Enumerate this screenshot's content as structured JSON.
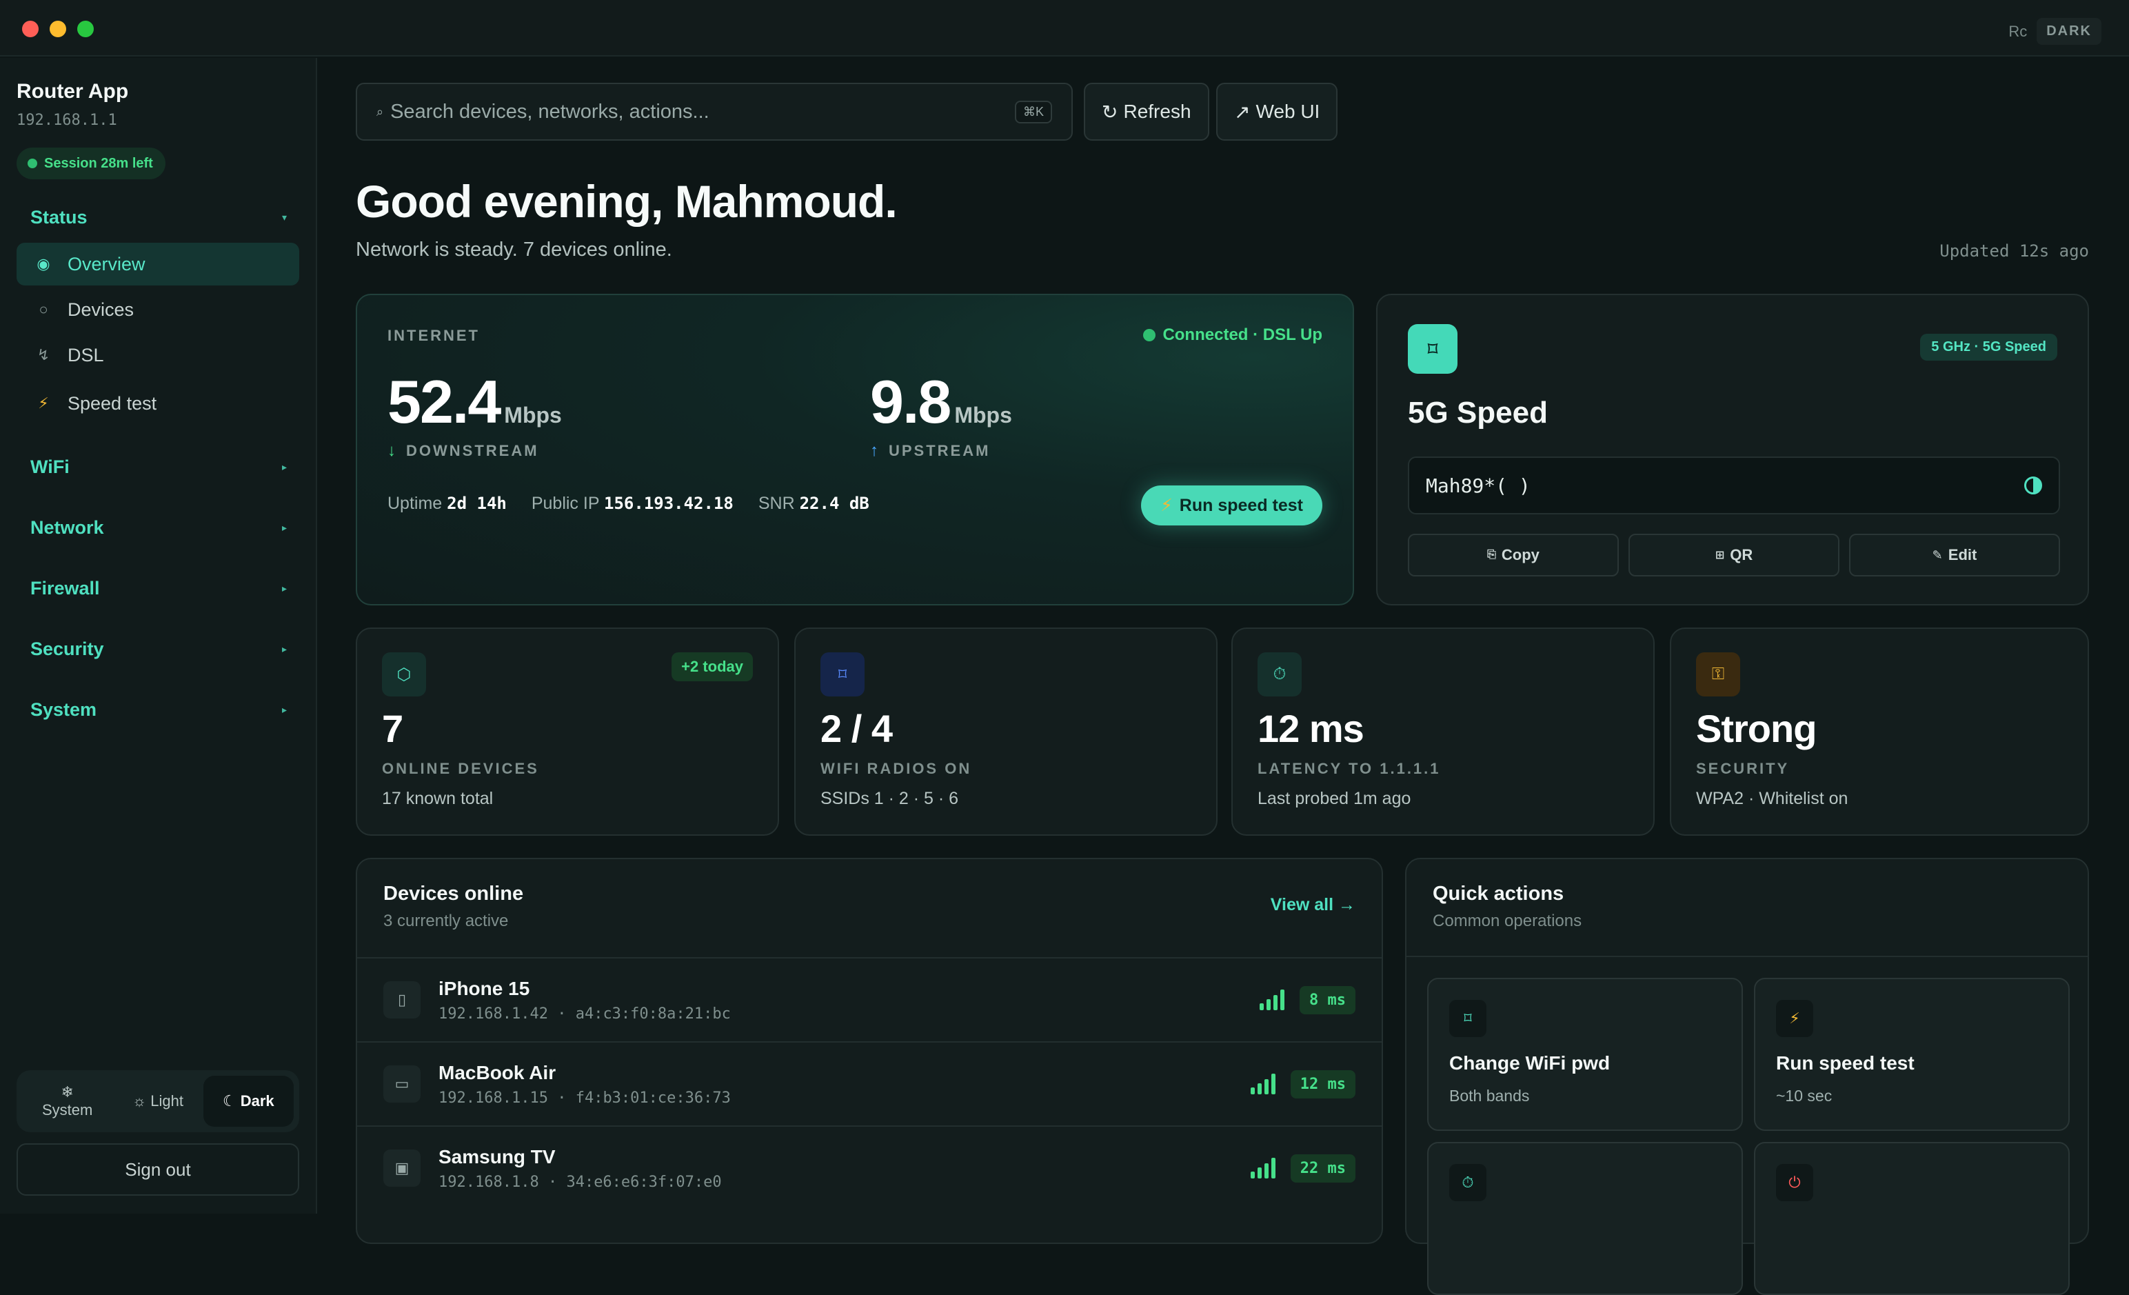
{
  "titlebar": {
    "rc": "Rc",
    "mode": "DARK"
  },
  "sidebar": {
    "app_name": "Router App",
    "ip": "192.168.1.1",
    "session": "Session 28m left",
    "status_label": "Status",
    "items": [
      {
        "label": "Overview",
        "icon": "◉"
      },
      {
        "label": "Devices",
        "icon": "○"
      },
      {
        "label": "DSL",
        "icon": "↯"
      },
      {
        "label": "Speed test",
        "icon": "⚡"
      }
    ],
    "sections": [
      "WiFi",
      "Network",
      "Firewall",
      "Security",
      "System"
    ],
    "theme": {
      "system": "System",
      "light": "Light",
      "dark": "Dark"
    },
    "sign_out": "Sign out"
  },
  "toolbar": {
    "search_placeholder": "Search devices, networks, actions...",
    "shortcut": "⌘K",
    "refresh": "Refresh",
    "web_ui": "Web UI"
  },
  "header": {
    "greeting": "Good evening, Mahmoud.",
    "subtitle": "Network is steady. 7 devices online.",
    "updated": "Updated 12s ago"
  },
  "internet": {
    "label": "INTERNET",
    "status": "Connected · DSL Up",
    "down_value": "52.4",
    "down_unit": "Mbps",
    "down_label": "DOWNSTREAM",
    "up_value": "9.8",
    "up_unit": "Mbps",
    "up_label": "UPSTREAM",
    "uptime_label": "Uptime",
    "uptime": "2d 14h",
    "ip_label": "Public IP",
    "public_ip": "156.193.42.18",
    "snr_label": "SNR",
    "snr": "22.4 dB",
    "run_label": "Run speed test"
  },
  "wifi": {
    "badge": "5 GHz · 5G Speed",
    "title": "5G Speed",
    "password": "Mah89*( )",
    "copy": "Copy",
    "qr": "QR",
    "edit": "Edit"
  },
  "stats": [
    {
      "value": "7",
      "name": "ONLINE DEVICES",
      "sub": "17 known total",
      "badge": "+2 today"
    },
    {
      "value": "2 / 4",
      "name": "WIFI RADIOS ON",
      "sub": "SSIDs 1 · 2 · 5 · 6"
    },
    {
      "value": "12 ms",
      "name": "LATENCY TO 1.1.1.1",
      "sub": "Last probed 1m ago"
    },
    {
      "value": "Strong",
      "name": "SECURITY",
      "sub": "WPA2 · Whitelist on"
    }
  ],
  "devices": {
    "title": "Devices online",
    "subtitle": "3 currently active",
    "view_all": "View all →",
    "rows": [
      {
        "name": "iPhone 15",
        "ip": "192.168.1.42",
        "mac": "a4:c3:f0:8a:21:bc",
        "latency": "8 ms"
      },
      {
        "name": "MacBook Air",
        "ip": "192.168.1.15",
        "mac": "f4:b3:01:ce:36:73",
        "latency": "12 ms"
      },
      {
        "name": "Samsung TV",
        "ip": "192.168.1.8",
        "mac": "34:e6:e6:3f:07:e0",
        "latency": "22 ms"
      }
    ]
  },
  "quick": {
    "title": "Quick actions",
    "subtitle": "Common operations",
    "items": [
      {
        "title": "Change WiFi pwd",
        "sub": "Both bands"
      },
      {
        "title": "Run speed test",
        "sub": "~10 sec"
      }
    ]
  }
}
